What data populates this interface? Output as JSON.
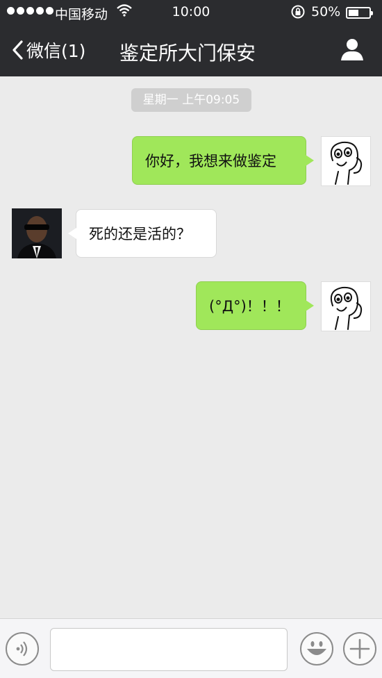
{
  "status_bar": {
    "carrier": "中国移动",
    "time": "10:00",
    "battery_percent": "50%",
    "battery_level": 0.5
  },
  "nav": {
    "back_label": "微信(1)",
    "title": "鉴定所大门保安"
  },
  "chat": {
    "timestamp": "星期一 上午09:05",
    "messages": [
      {
        "from": "me",
        "text": "你好，我想来做鉴定"
      },
      {
        "from": "them",
        "text": "死的还是活的？"
      },
      {
        "from": "me",
        "text": "(°Д°)！！！"
      }
    ]
  },
  "input_bar": {
    "voice_icon": "voice-icon",
    "emoji_icon": "emoji-icon",
    "plus_icon": "plus-icon"
  },
  "colors": {
    "nav_bg": "#2b2c2f",
    "chat_bg": "#ebebeb",
    "bubble_out": "#a0e75a",
    "bubble_in": "#ffffff"
  }
}
